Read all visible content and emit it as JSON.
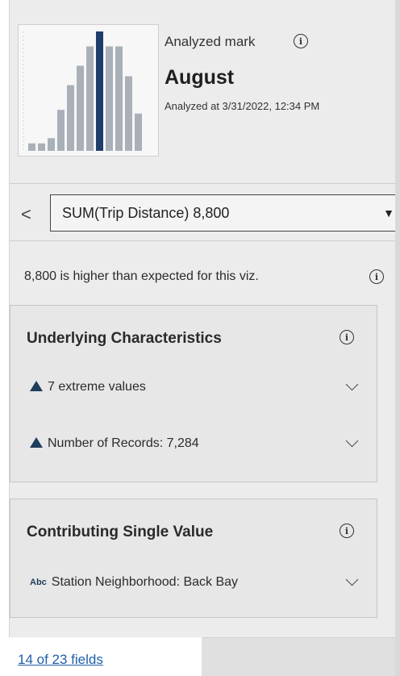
{
  "header": {
    "analyzed_label": "Analyzed mark",
    "mark_title": "August",
    "analyzed_at": "Analyzed at 3/31/2022, 12:34 PM"
  },
  "thumbnail": {
    "bar_values": [
      10,
      10,
      17,
      55,
      88,
      114,
      140,
      160,
      140,
      140,
      100,
      50
    ],
    "highlight_index": 7,
    "bar_color": "#a9b0b8",
    "highlight_color": "#1f3d6b"
  },
  "measure": {
    "label": "SUM(Trip Distance)  8,800"
  },
  "explanation": "8,800 is higher than expected for this viz.",
  "underlying": {
    "title": "Underlying Characteristics",
    "items": [
      {
        "label": "7 extreme values"
      },
      {
        "label": "Number of Records: 7,284"
      }
    ]
  },
  "contributing": {
    "title": "Contributing Single Value",
    "items": [
      {
        "label": "Station Neighborhood: Back Bay"
      }
    ]
  },
  "footer": {
    "fields_link": "14 of 23 fields"
  },
  "icons": {
    "info": "info-icon",
    "back": "chevron-left-icon",
    "dropdown": "caret-down-icon",
    "expand": "chevron-down-icon",
    "up": "triangle-up-icon",
    "text-field": "abc-icon"
  },
  "colors": {
    "accent_dark": "#1f3d5c",
    "link": "#1f5fa8"
  },
  "text": {
    "info_glyph": "i",
    "back_glyph": "<",
    "caret_glyph": "▼",
    "abc_glyph": "Abc"
  }
}
